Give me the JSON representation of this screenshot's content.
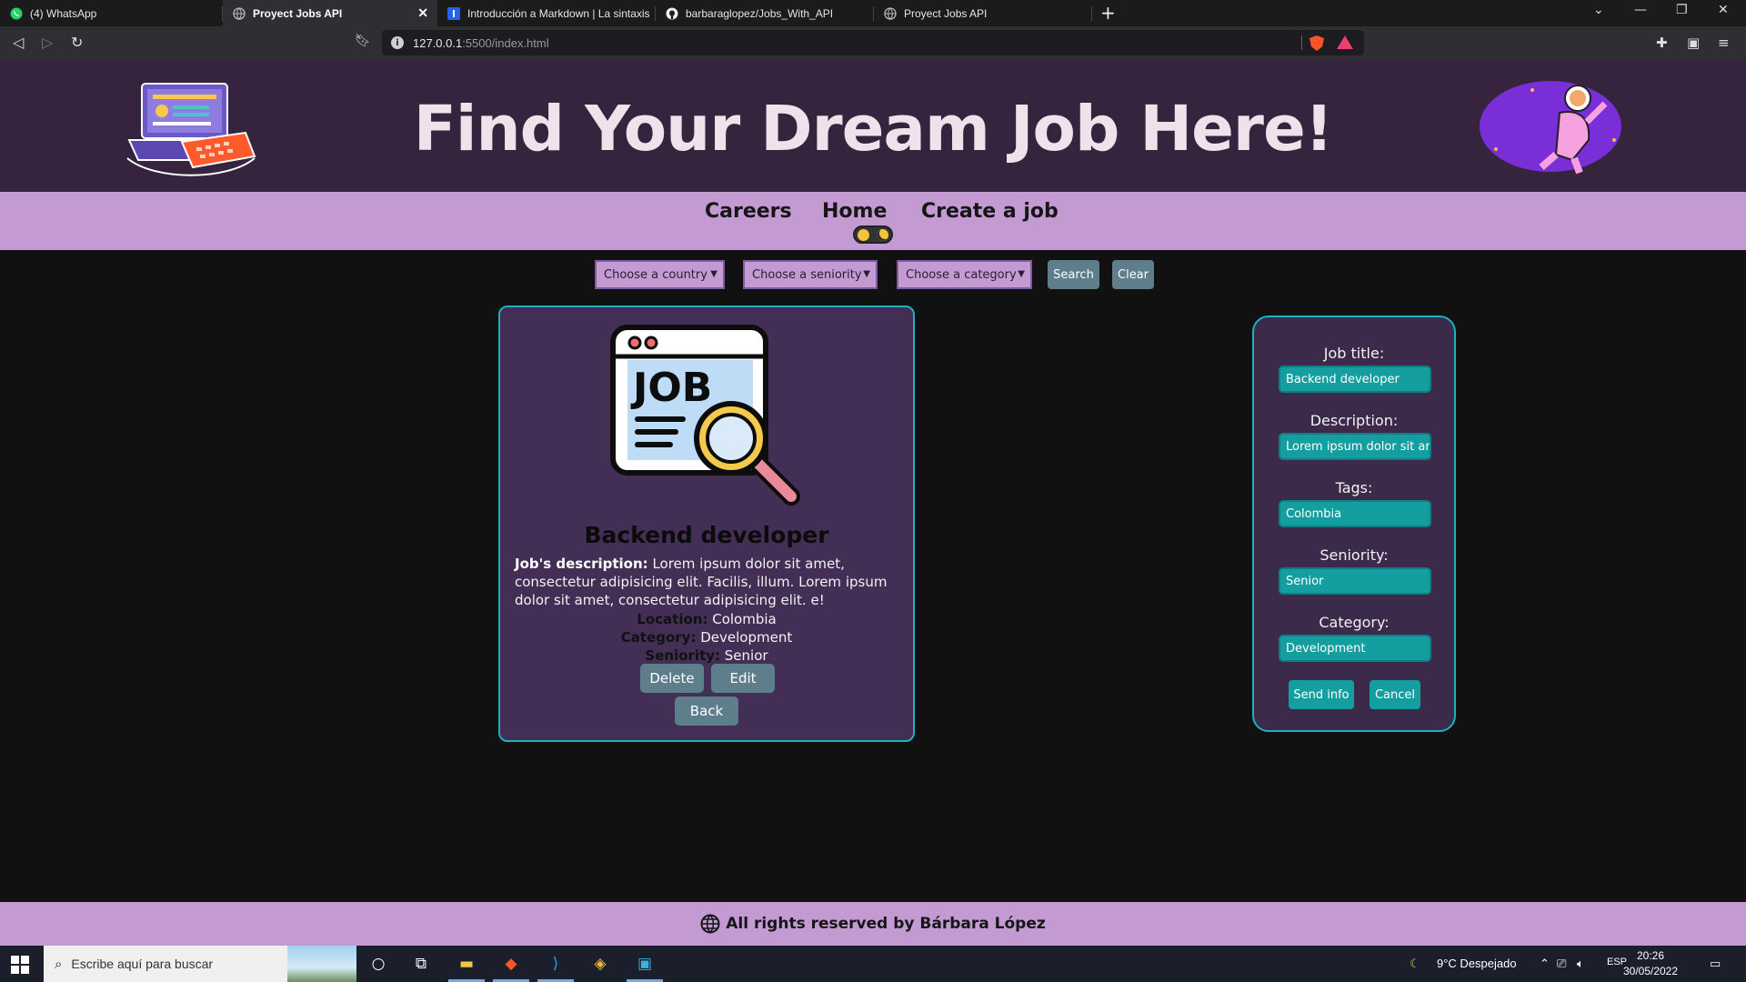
{
  "browser": {
    "tabs": [
      {
        "label": "(4) WhatsApp",
        "icon": "whatsapp-icon",
        "active": false
      },
      {
        "label": "Proyect Jobs API",
        "icon": "globe-icon",
        "active": true
      },
      {
        "label": "Introducción a Markdown | La sintaxis",
        "icon": "markdown-icon",
        "active": false
      },
      {
        "label": "barbaraglopez/Jobs_With_API",
        "icon": "github-icon",
        "active": false
      },
      {
        "label": "Proyect Jobs API",
        "icon": "globe-icon",
        "active": false
      }
    ],
    "url_host": "127.0.0.1",
    "url_rest": ":5500/index.html"
  },
  "hero": {
    "title": "Find Your Dream Job Here!"
  },
  "nav": {
    "careers": "Careers",
    "home": "Home",
    "create": "Create a job"
  },
  "filters": {
    "country": "Choose a country",
    "seniority": "Choose a seniority",
    "category": "Choose a category",
    "search": "Search",
    "clear": "Clear"
  },
  "job": {
    "title": "Backend developer",
    "desc_label": "Job's description:",
    "description": " Lorem ipsum dolor sit amet, consectetur adipisicing elit. Facilis, illum. Lorem ipsum dolor sit amet, consectetur adipisicing elit. e!",
    "location_label": "Location:",
    "location": " Colombia",
    "category_label": "Category:",
    "category": " Development",
    "seniority_label": "Seniority:",
    "seniority": " Senior",
    "delete": "Delete",
    "edit": "Edit",
    "back": "Back"
  },
  "form": {
    "title_label": "Job title:",
    "title_value": "Backend developer",
    "desc_label": "Description:",
    "desc_value": "Lorem ipsum dolor sit amet",
    "tags_label": "Tags:",
    "tags_value": "Colombia",
    "seniority_label": "Seniority:",
    "seniority_value": "Senior",
    "category_label": "Category:",
    "category_value": "Development",
    "send": "Send info",
    "cancel": "Cancel"
  },
  "footer": {
    "text": "All rights reserved by Bárbara López"
  },
  "taskbar": {
    "search_placeholder": "Escribe aquí para buscar",
    "weather": "9°C  Despejado",
    "lang": "ESP",
    "time": "20:26",
    "date": "30/05/2022"
  },
  "colors": {
    "hero_bg": "#36243f",
    "nav_bg": "#c39ad2",
    "card_bg": "#432f55",
    "accent": "#18b3c1",
    "input_bg": "#149ea0",
    "button_grey": "#5e7e8c"
  }
}
